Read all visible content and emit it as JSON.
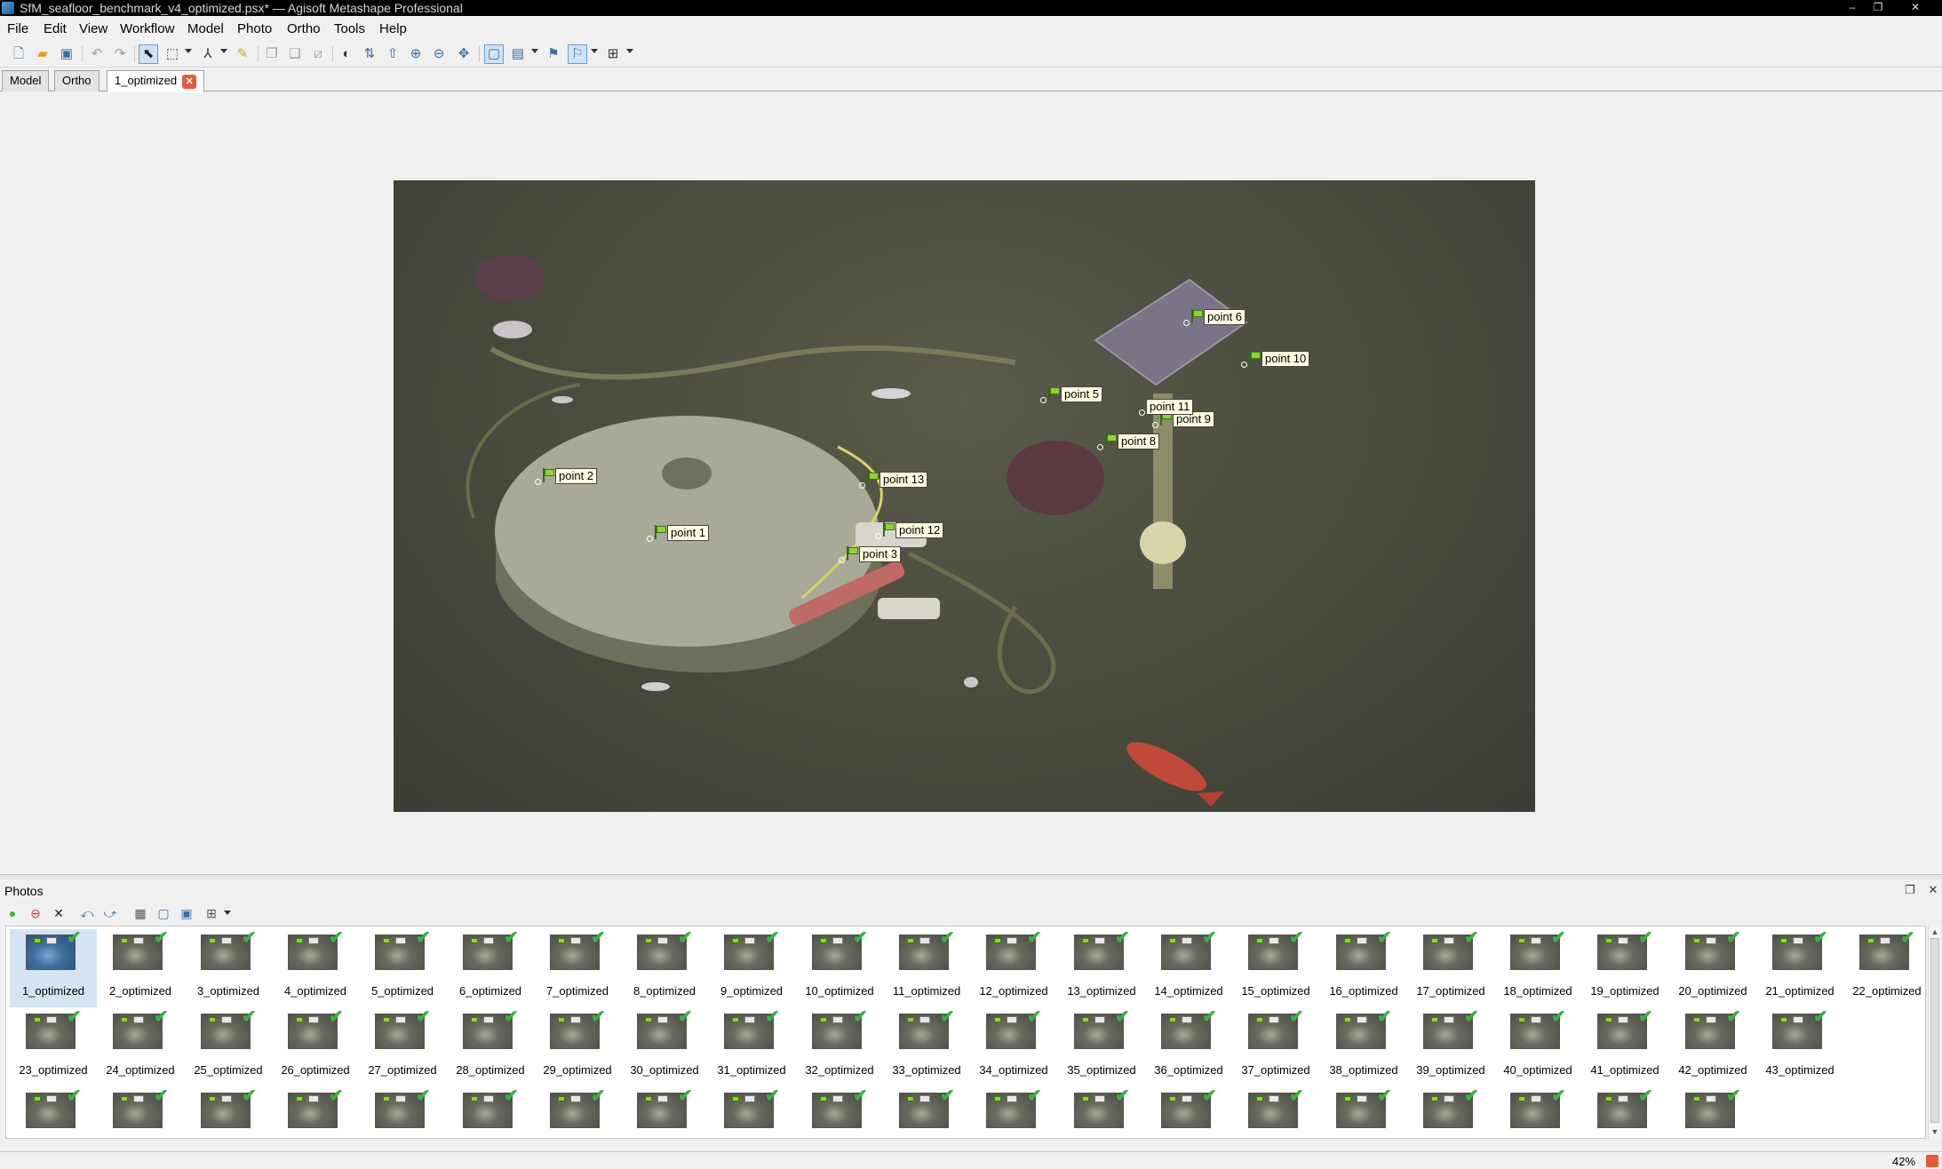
{
  "window": {
    "title": "SfM_seafloor_benchmark_v4_optimized.psx* — Agisoft Metashape Professional",
    "minimize_glyph": "–",
    "maximize_glyph": "❐",
    "close_glyph": "✕"
  },
  "menu": [
    "File",
    "Edit",
    "View",
    "Workflow",
    "Model",
    "Photo",
    "Ortho",
    "Tools",
    "Help"
  ],
  "toolbar": {
    "icons": [
      "new-icon",
      "open-icon",
      "save-icon",
      "undo-icon",
      "redo-icon",
      "navigation-icon",
      "rectangle-selection-icon",
      "ruler-icon",
      "brush-icon",
      "copy-icon",
      "paste-icon",
      "crop-icon",
      "color-icon",
      "align-icon",
      "upload-icon",
      "zoom-in-icon",
      "zoom-out-icon",
      "move-icon",
      "mask-icon",
      "marker-icon",
      "grid-icon"
    ]
  },
  "tabs": [
    {
      "label": "Model",
      "active": false
    },
    {
      "label": "Ortho",
      "active": false
    },
    {
      "label": "1_optimized",
      "active": true,
      "close_glyph": "✕"
    }
  ],
  "markers": [
    {
      "label": "point 1"
    },
    {
      "label": "point 2"
    },
    {
      "label": "point 3"
    },
    {
      "label": "point 5"
    },
    {
      "label": "point 6"
    },
    {
      "label": "point 8"
    },
    {
      "label": "point 9"
    },
    {
      "label": "point 10"
    },
    {
      "label": "point 11"
    },
    {
      "label": "point 12"
    },
    {
      "label": "point 13"
    }
  ],
  "photos_panel": {
    "title": "Photos",
    "restore_glyph": "❐",
    "close_glyph": "✕",
    "selected": "1_optimized",
    "thumbnails": [
      "1_optimized",
      "2_optimized",
      "3_optimized",
      "4_optimized",
      "5_optimized",
      "6_optimized",
      "7_optimized",
      "8_optimized",
      "9_optimized",
      "10_optimized",
      "11_optimized",
      "12_optimized",
      "13_optimized",
      "14_optimized",
      "15_optimized",
      "16_optimized",
      "17_optimized",
      "18_optimized",
      "19_optimized",
      "20_optimized",
      "21_optimized",
      "22_optimized",
      "23_optimized",
      "24_optimized",
      "25_optimized",
      "26_optimized",
      "27_optimized",
      "28_optimized",
      "29_optimized",
      "30_optimized",
      "31_optimized",
      "32_optimized",
      "33_optimized",
      "34_optimized",
      "35_optimized",
      "36_optimized",
      "37_optimized",
      "38_optimized",
      "39_optimized",
      "40_optimized",
      "41_optimized",
      "42_optimized",
      "43_optimized"
    ],
    "third_row_count": 20,
    "check_glyph": "✔"
  },
  "status": {
    "zoom": "42%"
  },
  "colors": {
    "accent": "#3a6ea5",
    "check": "#3cb043",
    "marker_flag": "#8fd13a",
    "close": "#e35b3b"
  }
}
